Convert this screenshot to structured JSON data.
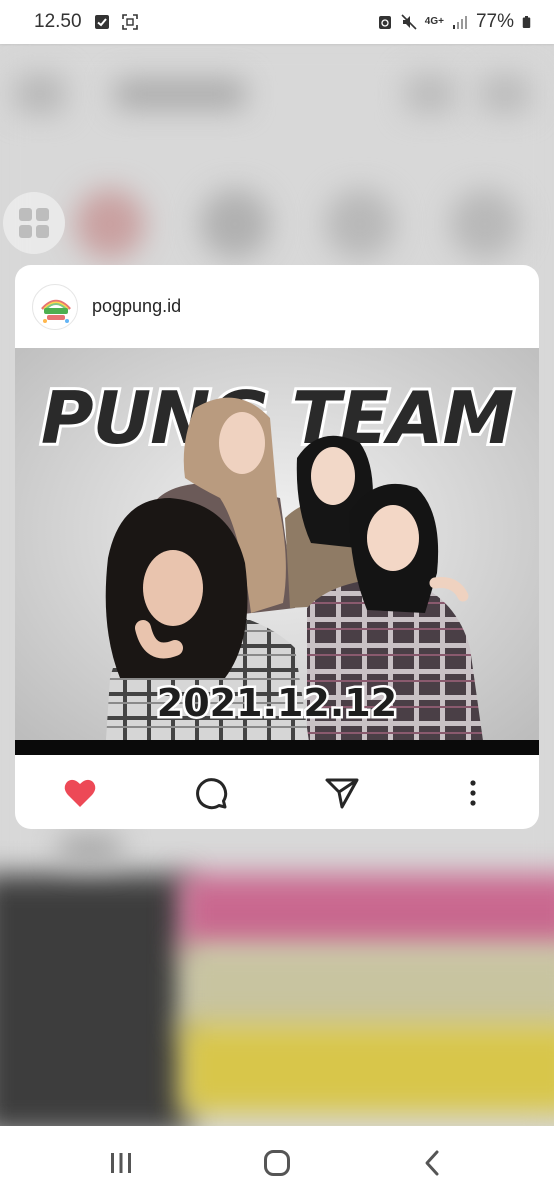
{
  "status_bar": {
    "time": "12.50",
    "network": "4G+",
    "battery": "77%"
  },
  "post": {
    "username": "pogpung.id",
    "avatar_text": "pogpung.id",
    "image_title": "PUNG TEAM",
    "image_date": "2021.12.12"
  },
  "actions": {
    "like_icon": "heart-icon",
    "comment_icon": "comment-icon",
    "share_icon": "send-icon",
    "more_icon": "more-vertical-icon"
  },
  "nav": {
    "recents_icon": "recents-icon",
    "home_icon": "home-icon",
    "back_icon": "back-icon"
  },
  "colors": {
    "like": "#ed4956",
    "icon": "#262626"
  }
}
